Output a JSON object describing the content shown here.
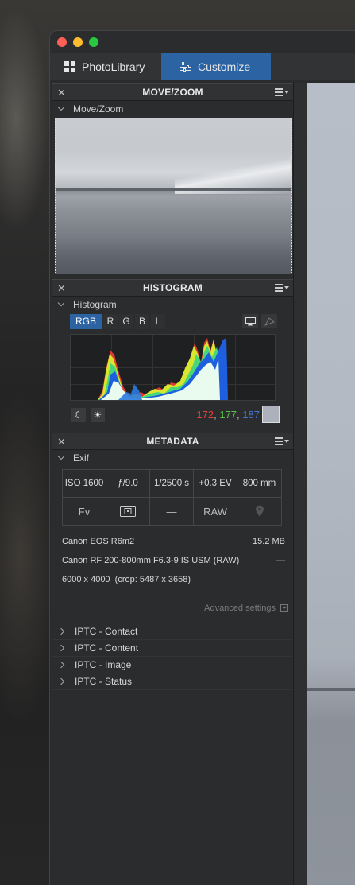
{
  "tabs": [
    {
      "label": "PhotoLibrary",
      "icon": "grid-icon",
      "active": false
    },
    {
      "label": "Customize",
      "icon": "sliders-icon",
      "active": true
    }
  ],
  "move_zoom": {
    "title": "MOVE/ZOOM",
    "section": "Move/Zoom"
  },
  "histogram": {
    "title": "HISTOGRAM",
    "section": "Histogram",
    "channels": [
      "RGB",
      "R",
      "G",
      "B",
      "L"
    ],
    "active_channel": "RGB",
    "values": {
      "r": "172",
      "g": "177",
      "b": "187"
    },
    "sep": ","
  },
  "metadata": {
    "title": "METADATA",
    "section": "Exif",
    "iso": "ISO 1600",
    "aperture": "ƒ/9.0",
    "shutter": "1/2500 s",
    "ev": "+0.3 EV",
    "focal": "800 mm",
    "mode": "Fv",
    "flash": "—",
    "format": "RAW",
    "camera": "Canon EOS R6m2",
    "size": "15.2 MB",
    "lens": "Canon RF 200-800mm F6.3-9 IS USM (RAW)",
    "lens_extra": "—",
    "dims": "6000 x 4000  (crop: 5487 x 3658)",
    "advanced": "Advanced settings",
    "iptc": [
      "IPTC - Contact",
      "IPTC - Content",
      "IPTC - Image",
      "IPTC - Status"
    ]
  },
  "colors": {
    "accent": "#2b63a3",
    "red": "#e0443a",
    "green": "#5bc24a",
    "blue": "#3f78d8"
  }
}
